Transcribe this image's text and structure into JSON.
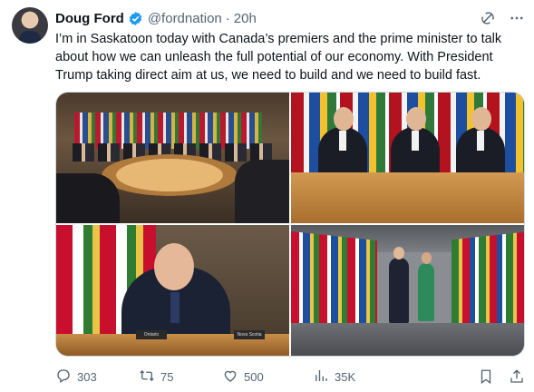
{
  "tweet": {
    "author_name": "Doug Ford",
    "handle": "@fordnation",
    "separator": "·",
    "time": "20h",
    "text": "I’m in Saskatoon today with Canada’s premiers and the prime minister to talk about how we can unleash the full potential of our economy. With President Trump taking direct aim at us, we need to build and we need to build fast."
  },
  "media": {
    "photo3_plates": [
      "Ontario",
      "Nova Scotia"
    ]
  },
  "actions": {
    "replies": "303",
    "reposts": "75",
    "likes": "500",
    "views": "35K"
  },
  "colors": {
    "text": "#0f1419",
    "secondary": "#536471",
    "verified": "#1d9bf0",
    "border": "#cfd9de"
  },
  "icons": [
    "verified-badge-icon",
    "grok-icon",
    "more-icon",
    "reply-icon",
    "repost-icon",
    "like-icon",
    "views-icon",
    "bookmark-icon",
    "share-icon"
  ]
}
